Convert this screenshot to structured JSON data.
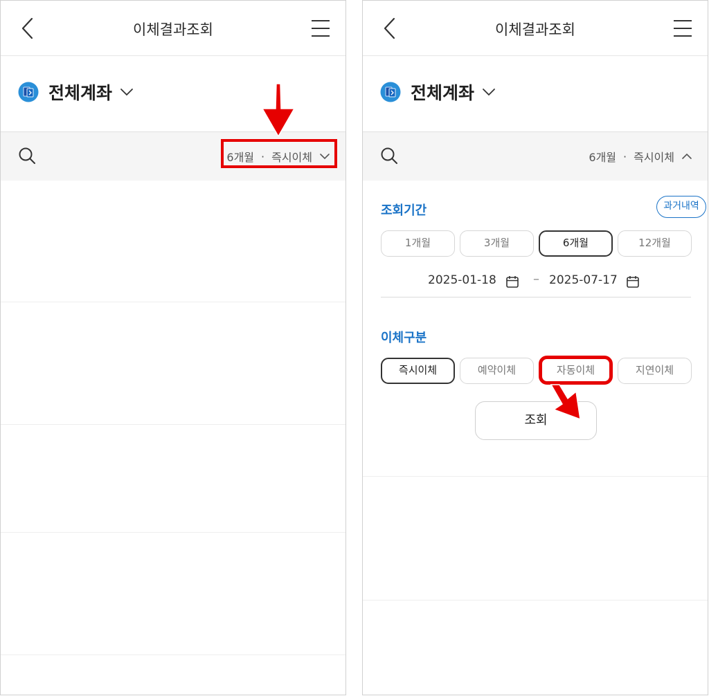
{
  "left_screen": {
    "header": {
      "title": "이체결과조회"
    },
    "account": {
      "name": "전체계좌"
    },
    "filter": {
      "period": "6개월",
      "separator": "·",
      "type": "즉시이체"
    }
  },
  "right_screen": {
    "header": {
      "title": "이체결과조회"
    },
    "account": {
      "name": "전체계좌"
    },
    "filter": {
      "period": "6개월",
      "separator": "·",
      "type": "즉시이체"
    },
    "period_section": {
      "label": "조회기간",
      "past_button": "과거내역",
      "options": [
        "1개월",
        "3개월",
        "6개월",
        "12개월"
      ],
      "selected": "6개월",
      "start_date": "2025-01-18",
      "date_separator": "–",
      "end_date": "2025-07-17"
    },
    "type_section": {
      "label": "이체구분",
      "options": [
        "즉시이체",
        "예약이체",
        "자동이체",
        "지연이체"
      ],
      "selected": "즉시이체"
    },
    "query_button": "조회"
  },
  "colors": {
    "accent": "#1a73c7",
    "annotation": "#e60000",
    "filter_bg": "#f5f5f5"
  },
  "icons": [
    "back-arrow-icon",
    "hamburger-menu-icon",
    "bank-logo-icon",
    "chevron-down-icon",
    "chevron-up-icon",
    "search-icon",
    "calendar-icon"
  ]
}
